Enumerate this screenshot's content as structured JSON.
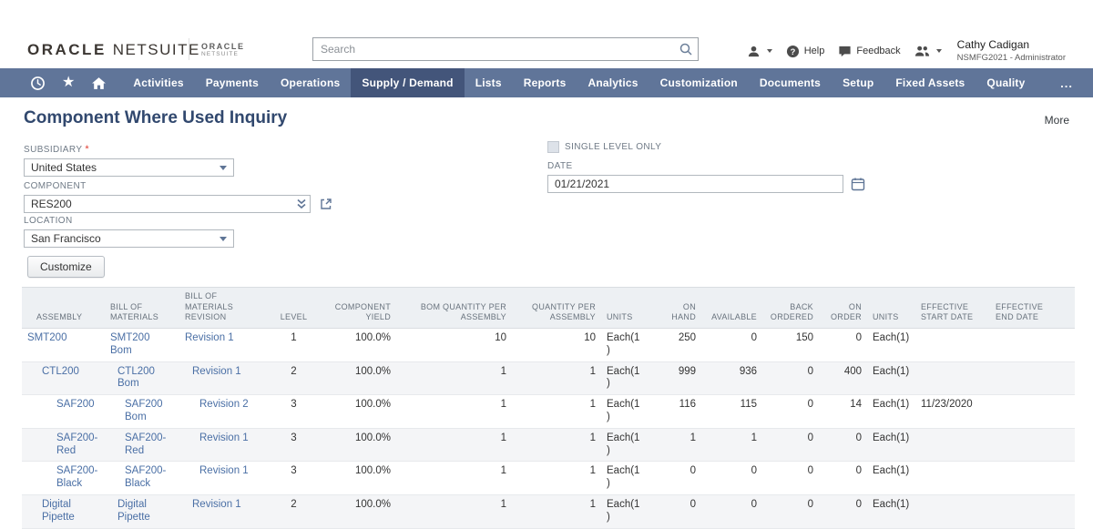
{
  "header": {
    "logo": {
      "oracle": "ORACLE",
      "netsuite": "NETSUITE"
    },
    "small_logo": {
      "line1": "ORACLE",
      "line2": "NETSUITE"
    },
    "search": {
      "placeholder": "Search"
    },
    "help_label": "Help",
    "feedback_label": "Feedback",
    "user": {
      "name": "Cathy Cadigan",
      "role": "NSMFG2021 - Administrator"
    }
  },
  "nav": {
    "items": [
      {
        "label": "Activities"
      },
      {
        "label": "Payments"
      },
      {
        "label": "Operations"
      },
      {
        "label": "Supply / Demand"
      },
      {
        "label": "Lists"
      },
      {
        "label": "Reports"
      },
      {
        "label": "Analytics"
      },
      {
        "label": "Customization"
      },
      {
        "label": "Documents"
      },
      {
        "label": "Setup"
      },
      {
        "label": "Fixed Assets"
      },
      {
        "label": "Quality"
      }
    ],
    "active": "Supply / Demand",
    "overflow_label": "..."
  },
  "page": {
    "title": "Component Where Used Inquiry",
    "more_label": "More"
  },
  "form": {
    "subsidiary": {
      "label": "SUBSIDIARY",
      "required_marker": "*",
      "value": "United States"
    },
    "component": {
      "label": "COMPONENT",
      "value": "RES200"
    },
    "location": {
      "label": "LOCATION",
      "value": "San Francisco"
    },
    "single_level": {
      "label": "SINGLE LEVEL ONLY",
      "checked": false
    },
    "date": {
      "label": "DATE",
      "value": "01/21/2021"
    }
  },
  "table": {
    "customize_label": "Customize",
    "columns": [
      {
        "key": "assembly",
        "label": "ASSEMBLY",
        "align": "left",
        "link": true
      },
      {
        "key": "bom",
        "label": "BILL OF\nMATERIALS",
        "align": "left",
        "link": true
      },
      {
        "key": "revision",
        "label": "BILL OF MATERIALS\nREVISION",
        "align": "left",
        "link": true
      },
      {
        "key": "level",
        "label": "LEVEL",
        "align": "center",
        "link": false
      },
      {
        "key": "yield",
        "label": "COMPONENT\nYIELD",
        "align": "right",
        "link": false
      },
      {
        "key": "bom_qty",
        "label": "BOM QUANTITY PER\nASSEMBLY",
        "align": "right",
        "link": false
      },
      {
        "key": "qty",
        "label": "QUANTITY PER\nASSEMBLY",
        "align": "right",
        "link": false
      },
      {
        "key": "units",
        "label": "UNITS",
        "align": "left",
        "link": false
      },
      {
        "key": "on_hand",
        "label": "ON\nHAND",
        "align": "right",
        "link": false
      },
      {
        "key": "available",
        "label": "AVAILABLE",
        "align": "right",
        "link": false
      },
      {
        "key": "back_ordered",
        "label": "BACK\nORDERED",
        "align": "right",
        "link": false
      },
      {
        "key": "on_order",
        "label": "ON\nORDER",
        "align": "right",
        "link": false
      },
      {
        "key": "units2",
        "label": "UNITS",
        "align": "left",
        "link": false
      },
      {
        "key": "eff_start",
        "label": "EFFECTIVE\nSTART DATE",
        "align": "left",
        "link": false
      },
      {
        "key": "eff_end",
        "label": "EFFECTIVE\nEND DATE",
        "align": "left",
        "link": false
      }
    ],
    "rows": [
      {
        "level": 1,
        "assembly": "SMT200",
        "bom": "SMT200 Bom",
        "revision": "Revision 1",
        "yield": "100.0%",
        "bom_qty": "10",
        "qty": "10",
        "units": "Each(1)",
        "on_hand": "250",
        "available": "0",
        "back_ordered": "150",
        "on_order": "0",
        "units2": "Each(1)",
        "eff_start": "",
        "eff_end": ""
      },
      {
        "level": 2,
        "assembly": "CTL200",
        "bom": "CTL200 Bom",
        "revision": "Revision 1",
        "yield": "100.0%",
        "bom_qty": "1",
        "qty": "1",
        "units": "Each(1)",
        "on_hand": "999",
        "available": "936",
        "back_ordered": "0",
        "on_order": "400",
        "units2": "Each(1)",
        "eff_start": "",
        "eff_end": ""
      },
      {
        "level": 3,
        "assembly": "SAF200",
        "bom": "SAF200 Bom",
        "revision": "Revision 2",
        "yield": "100.0%",
        "bom_qty": "1",
        "qty": "1",
        "units": "Each(1)",
        "on_hand": "116",
        "available": "115",
        "back_ordered": "0",
        "on_order": "14",
        "units2": "Each(1)",
        "eff_start": "11/23/2020",
        "eff_end": ""
      },
      {
        "level": 3,
        "assembly": "SAF200-Red",
        "bom": "SAF200-Red",
        "revision": "Revision 1",
        "yield": "100.0%",
        "bom_qty": "1",
        "qty": "1",
        "units": "Each(1)",
        "on_hand": "1",
        "available": "1",
        "back_ordered": "0",
        "on_order": "0",
        "units2": "Each(1)",
        "eff_start": "",
        "eff_end": ""
      },
      {
        "level": 3,
        "assembly": "SAF200-Black",
        "bom": "SAF200-Black",
        "revision": "Revision 1",
        "yield": "100.0%",
        "bom_qty": "1",
        "qty": "1",
        "units": "Each(1)",
        "on_hand": "0",
        "available": "0",
        "back_ordered": "0",
        "on_order": "0",
        "units2": "Each(1)",
        "eff_start": "",
        "eff_end": ""
      },
      {
        "level": 2,
        "assembly": "Digital Pipette",
        "bom": "Digital Pipette",
        "revision": "Revision 1",
        "yield": "100.0%",
        "bom_qty": "1",
        "qty": "1",
        "units": "Each(1)",
        "on_hand": "0",
        "available": "0",
        "back_ordered": "0",
        "on_order": "0",
        "units2": "Each(1)",
        "eff_start": "",
        "eff_end": ""
      }
    ]
  },
  "colors": {
    "nav_bg": "#607599",
    "nav_active_bg": "#43557a",
    "link": "#4a6fa5",
    "title": "#31486e",
    "required": "#e03c31"
  }
}
